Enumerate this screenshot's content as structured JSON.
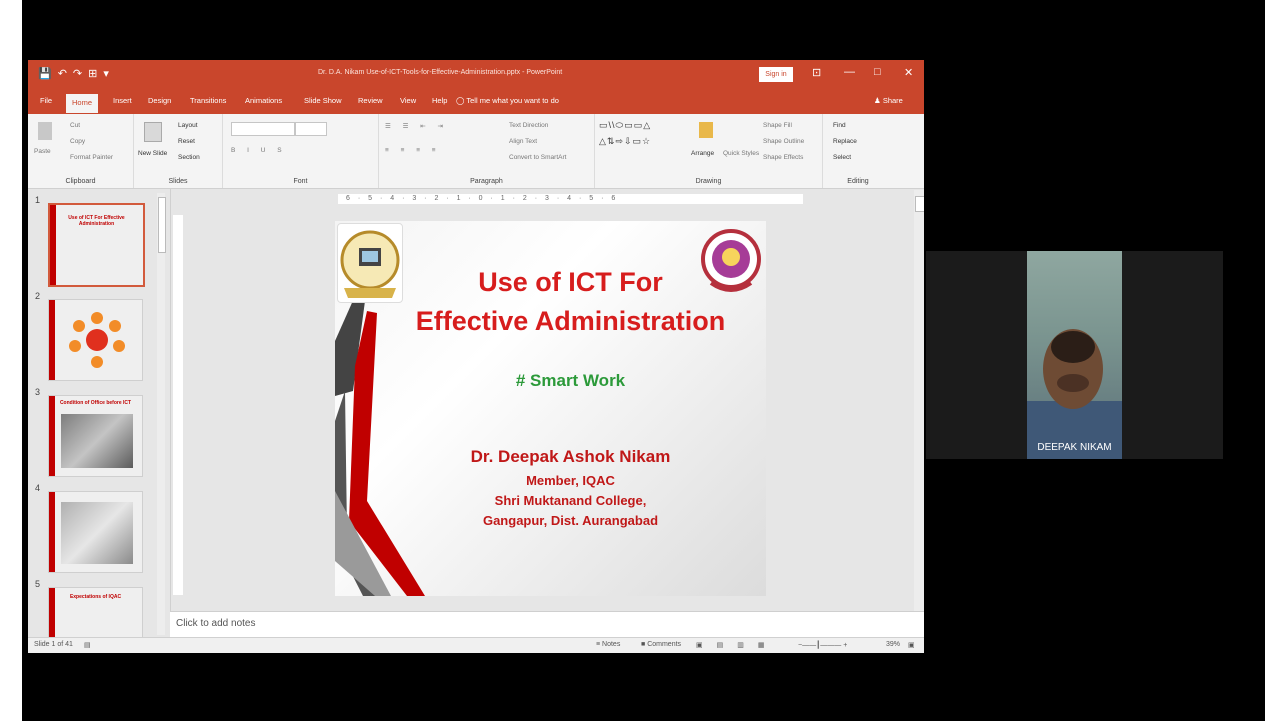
{
  "window": {
    "qat_icons": [
      "save-icon",
      "undo-icon",
      "redo-icon",
      "start-from-beginning-icon",
      "customize-icon"
    ],
    "title": "Dr. D.A. Nikam Use-of-ICT-Tools-for-Effective-Administration.pptx - PowerPoint",
    "sign_in": "Sign in",
    "ribbon_display_glyph": "⊡",
    "minimize_glyph": "—",
    "maximize_glyph": "□",
    "close_glyph": "✕"
  },
  "tabs": [
    "File",
    "Home",
    "Insert",
    "Design",
    "Transitions",
    "Animations",
    "Slide Show",
    "Review",
    "View",
    "Help"
  ],
  "tell_me": "Tell me what you want to do",
  "share": "Share",
  "ribbon": {
    "clipboard": {
      "label": "Clipboard",
      "cut": "Cut",
      "copy": "Copy",
      "paste": "Paste",
      "format_painter": "Format Painter"
    },
    "slides": {
      "label": "Slides",
      "new_slide": "New Slide",
      "layout": "Layout",
      "reset": "Reset",
      "section": "Section"
    },
    "font": {
      "label": "Font"
    },
    "paragraph": {
      "label": "Paragraph",
      "text_direction": "Text Direction",
      "align_text": "Align Text",
      "convert": "Convert to SmartArt"
    },
    "drawing": {
      "label": "Drawing",
      "arrange": "Arrange",
      "quick_styles": "Quick Styles",
      "shape_fill": "Shape Fill",
      "shape_outline": "Shape Outline",
      "shape_effects": "Shape Effects"
    },
    "editing": {
      "label": "Editing",
      "find": "Find",
      "replace": "Replace",
      "select": "Select"
    }
  },
  "ruler_ticks": "6 · 5 · 4 · 3 · 2 · 1 · 0 · 1 · 2 · 3 · 4 · 5 · 6",
  "thumbnails": [
    {
      "num": "1",
      "title": "Use of ICT For Effective Administration"
    },
    {
      "num": "2",
      "title": ""
    },
    {
      "num": "3",
      "title": "Condition of Office before ICT"
    },
    {
      "num": "4",
      "title": ""
    },
    {
      "num": "5",
      "title": "Expectations of IQAC"
    }
  ],
  "slide": {
    "title_line1": "Use of ICT For",
    "title_line2": "Effective Administration",
    "tagline": "# Smart Work",
    "author": "Dr. Deepak Ashok Nikam",
    "role": "Member, IQAC",
    "college": "Shri Muktanand College,",
    "place": "Gangapur, Dist. Aurangabad"
  },
  "notes_placeholder": "Click to add notes",
  "status": {
    "slide_info": "Slide 1 of 41",
    "notes": "Notes",
    "comments": "Comments",
    "zoom": "39%"
  },
  "participant": {
    "name": "DEEPAK NIKAM"
  },
  "colors": {
    "accent": "#c9462c",
    "title_red": "#d71d1d",
    "tag_green": "#2c9a3a"
  }
}
